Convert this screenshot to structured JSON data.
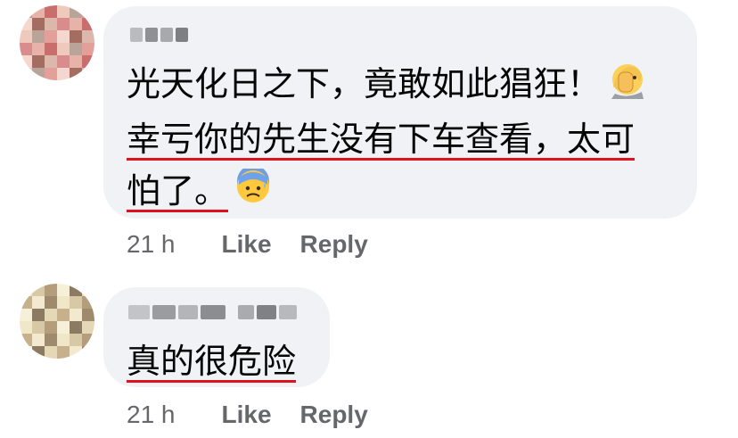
{
  "comments": [
    {
      "author_blurred": "",
      "lines": [
        "光天化日之下，竟敢如此猖狂！",
        "幸亏你的先生没有下车查看，太可",
        "怕了。"
      ],
      "emojis": [
        "face-palm-icon",
        "anxious-face-with-sweat-icon"
      ],
      "time": "21 h",
      "like_label": "Like",
      "reply_label": "Reply"
    },
    {
      "author_blurred": "",
      "lines": [
        "真的很危险"
      ],
      "time": "21 h",
      "like_label": "Like",
      "reply_label": "Reply"
    }
  ],
  "colors": {
    "bubble": "#f0f2f5",
    "text": "#050505",
    "meta": "#65676b",
    "underline": "#e0121e"
  }
}
